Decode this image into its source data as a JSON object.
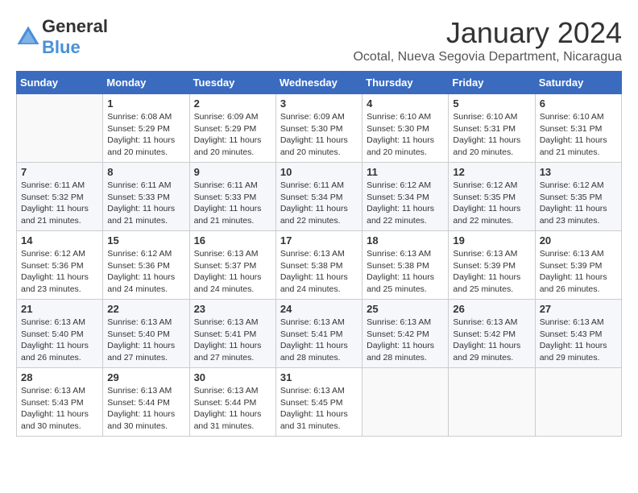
{
  "header": {
    "logo_general": "General",
    "logo_blue": "Blue",
    "month_year": "January 2024",
    "location": "Ocotal, Nueva Segovia Department, Nicaragua"
  },
  "weekdays": [
    "Sunday",
    "Monday",
    "Tuesday",
    "Wednesday",
    "Thursday",
    "Friday",
    "Saturday"
  ],
  "weeks": [
    [
      {
        "day": "",
        "sunrise": "",
        "sunset": "",
        "daylight": ""
      },
      {
        "day": "1",
        "sunrise": "Sunrise: 6:08 AM",
        "sunset": "Sunset: 5:29 PM",
        "daylight": "Daylight: 11 hours and 20 minutes."
      },
      {
        "day": "2",
        "sunrise": "Sunrise: 6:09 AM",
        "sunset": "Sunset: 5:29 PM",
        "daylight": "Daylight: 11 hours and 20 minutes."
      },
      {
        "day": "3",
        "sunrise": "Sunrise: 6:09 AM",
        "sunset": "Sunset: 5:30 PM",
        "daylight": "Daylight: 11 hours and 20 minutes."
      },
      {
        "day": "4",
        "sunrise": "Sunrise: 6:10 AM",
        "sunset": "Sunset: 5:30 PM",
        "daylight": "Daylight: 11 hours and 20 minutes."
      },
      {
        "day": "5",
        "sunrise": "Sunrise: 6:10 AM",
        "sunset": "Sunset: 5:31 PM",
        "daylight": "Daylight: 11 hours and 20 minutes."
      },
      {
        "day": "6",
        "sunrise": "Sunrise: 6:10 AM",
        "sunset": "Sunset: 5:31 PM",
        "daylight": "Daylight: 11 hours and 21 minutes."
      }
    ],
    [
      {
        "day": "7",
        "sunrise": "Sunrise: 6:11 AM",
        "sunset": "Sunset: 5:32 PM",
        "daylight": "Daylight: 11 hours and 21 minutes."
      },
      {
        "day": "8",
        "sunrise": "Sunrise: 6:11 AM",
        "sunset": "Sunset: 5:33 PM",
        "daylight": "Daylight: 11 hours and 21 minutes."
      },
      {
        "day": "9",
        "sunrise": "Sunrise: 6:11 AM",
        "sunset": "Sunset: 5:33 PM",
        "daylight": "Daylight: 11 hours and 21 minutes."
      },
      {
        "day": "10",
        "sunrise": "Sunrise: 6:11 AM",
        "sunset": "Sunset: 5:34 PM",
        "daylight": "Daylight: 11 hours and 22 minutes."
      },
      {
        "day": "11",
        "sunrise": "Sunrise: 6:12 AM",
        "sunset": "Sunset: 5:34 PM",
        "daylight": "Daylight: 11 hours and 22 minutes."
      },
      {
        "day": "12",
        "sunrise": "Sunrise: 6:12 AM",
        "sunset": "Sunset: 5:35 PM",
        "daylight": "Daylight: 11 hours and 22 minutes."
      },
      {
        "day": "13",
        "sunrise": "Sunrise: 6:12 AM",
        "sunset": "Sunset: 5:35 PM",
        "daylight": "Daylight: 11 hours and 23 minutes."
      }
    ],
    [
      {
        "day": "14",
        "sunrise": "Sunrise: 6:12 AM",
        "sunset": "Sunset: 5:36 PM",
        "daylight": "Daylight: 11 hours and 23 minutes."
      },
      {
        "day": "15",
        "sunrise": "Sunrise: 6:12 AM",
        "sunset": "Sunset: 5:36 PM",
        "daylight": "Daylight: 11 hours and 24 minutes."
      },
      {
        "day": "16",
        "sunrise": "Sunrise: 6:13 AM",
        "sunset": "Sunset: 5:37 PM",
        "daylight": "Daylight: 11 hours and 24 minutes."
      },
      {
        "day": "17",
        "sunrise": "Sunrise: 6:13 AM",
        "sunset": "Sunset: 5:38 PM",
        "daylight": "Daylight: 11 hours and 24 minutes."
      },
      {
        "day": "18",
        "sunrise": "Sunrise: 6:13 AM",
        "sunset": "Sunset: 5:38 PM",
        "daylight": "Daylight: 11 hours and 25 minutes."
      },
      {
        "day": "19",
        "sunrise": "Sunrise: 6:13 AM",
        "sunset": "Sunset: 5:39 PM",
        "daylight": "Daylight: 11 hours and 25 minutes."
      },
      {
        "day": "20",
        "sunrise": "Sunrise: 6:13 AM",
        "sunset": "Sunset: 5:39 PM",
        "daylight": "Daylight: 11 hours and 26 minutes."
      }
    ],
    [
      {
        "day": "21",
        "sunrise": "Sunrise: 6:13 AM",
        "sunset": "Sunset: 5:40 PM",
        "daylight": "Daylight: 11 hours and 26 minutes."
      },
      {
        "day": "22",
        "sunrise": "Sunrise: 6:13 AM",
        "sunset": "Sunset: 5:40 PM",
        "daylight": "Daylight: 11 hours and 27 minutes."
      },
      {
        "day": "23",
        "sunrise": "Sunrise: 6:13 AM",
        "sunset": "Sunset: 5:41 PM",
        "daylight": "Daylight: 11 hours and 27 minutes."
      },
      {
        "day": "24",
        "sunrise": "Sunrise: 6:13 AM",
        "sunset": "Sunset: 5:41 PM",
        "daylight": "Daylight: 11 hours and 28 minutes."
      },
      {
        "day": "25",
        "sunrise": "Sunrise: 6:13 AM",
        "sunset": "Sunset: 5:42 PM",
        "daylight": "Daylight: 11 hours and 28 minutes."
      },
      {
        "day": "26",
        "sunrise": "Sunrise: 6:13 AM",
        "sunset": "Sunset: 5:42 PM",
        "daylight": "Daylight: 11 hours and 29 minutes."
      },
      {
        "day": "27",
        "sunrise": "Sunrise: 6:13 AM",
        "sunset": "Sunset: 5:43 PM",
        "daylight": "Daylight: 11 hours and 29 minutes."
      }
    ],
    [
      {
        "day": "28",
        "sunrise": "Sunrise: 6:13 AM",
        "sunset": "Sunset: 5:43 PM",
        "daylight": "Daylight: 11 hours and 30 minutes."
      },
      {
        "day": "29",
        "sunrise": "Sunrise: 6:13 AM",
        "sunset": "Sunset: 5:44 PM",
        "daylight": "Daylight: 11 hours and 30 minutes."
      },
      {
        "day": "30",
        "sunrise": "Sunrise: 6:13 AM",
        "sunset": "Sunset: 5:44 PM",
        "daylight": "Daylight: 11 hours and 31 minutes."
      },
      {
        "day": "31",
        "sunrise": "Sunrise: 6:13 AM",
        "sunset": "Sunset: 5:45 PM",
        "daylight": "Daylight: 11 hours and 31 minutes."
      },
      {
        "day": "",
        "sunrise": "",
        "sunset": "",
        "daylight": ""
      },
      {
        "day": "",
        "sunrise": "",
        "sunset": "",
        "daylight": ""
      },
      {
        "day": "",
        "sunrise": "",
        "sunset": "",
        "daylight": ""
      }
    ]
  ]
}
